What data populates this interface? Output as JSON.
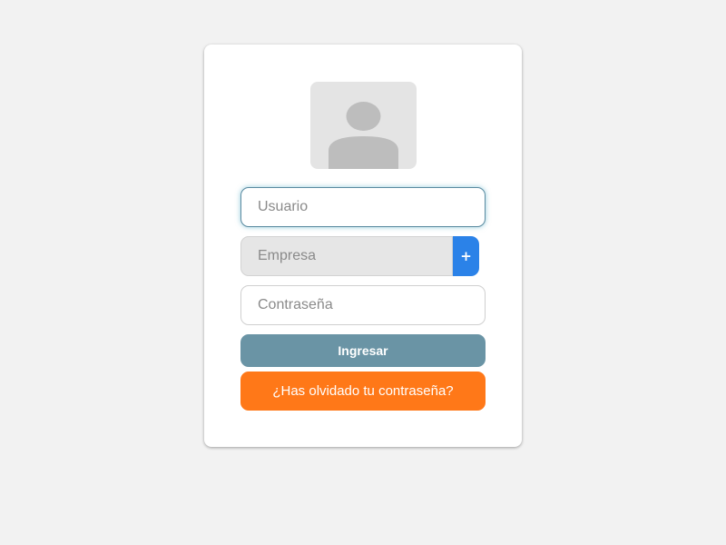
{
  "login_form": {
    "avatar_icon": "user-silhouette-icon",
    "username_placeholder": "Usuario",
    "company_placeholder": "Empresa",
    "add_company_label": "+",
    "password_placeholder": "Contraseña",
    "login_label": "Ingresar",
    "forgot_password_label": "¿Has olvidado tu contraseña?"
  },
  "colors": {
    "page_background": "#f2f2f2",
    "card_background": "#ffffff",
    "login_button": "#6a94a5",
    "forgot_button": "#ff7818",
    "add_button": "#2b82e8",
    "focus_border": "#5a8aa0"
  }
}
